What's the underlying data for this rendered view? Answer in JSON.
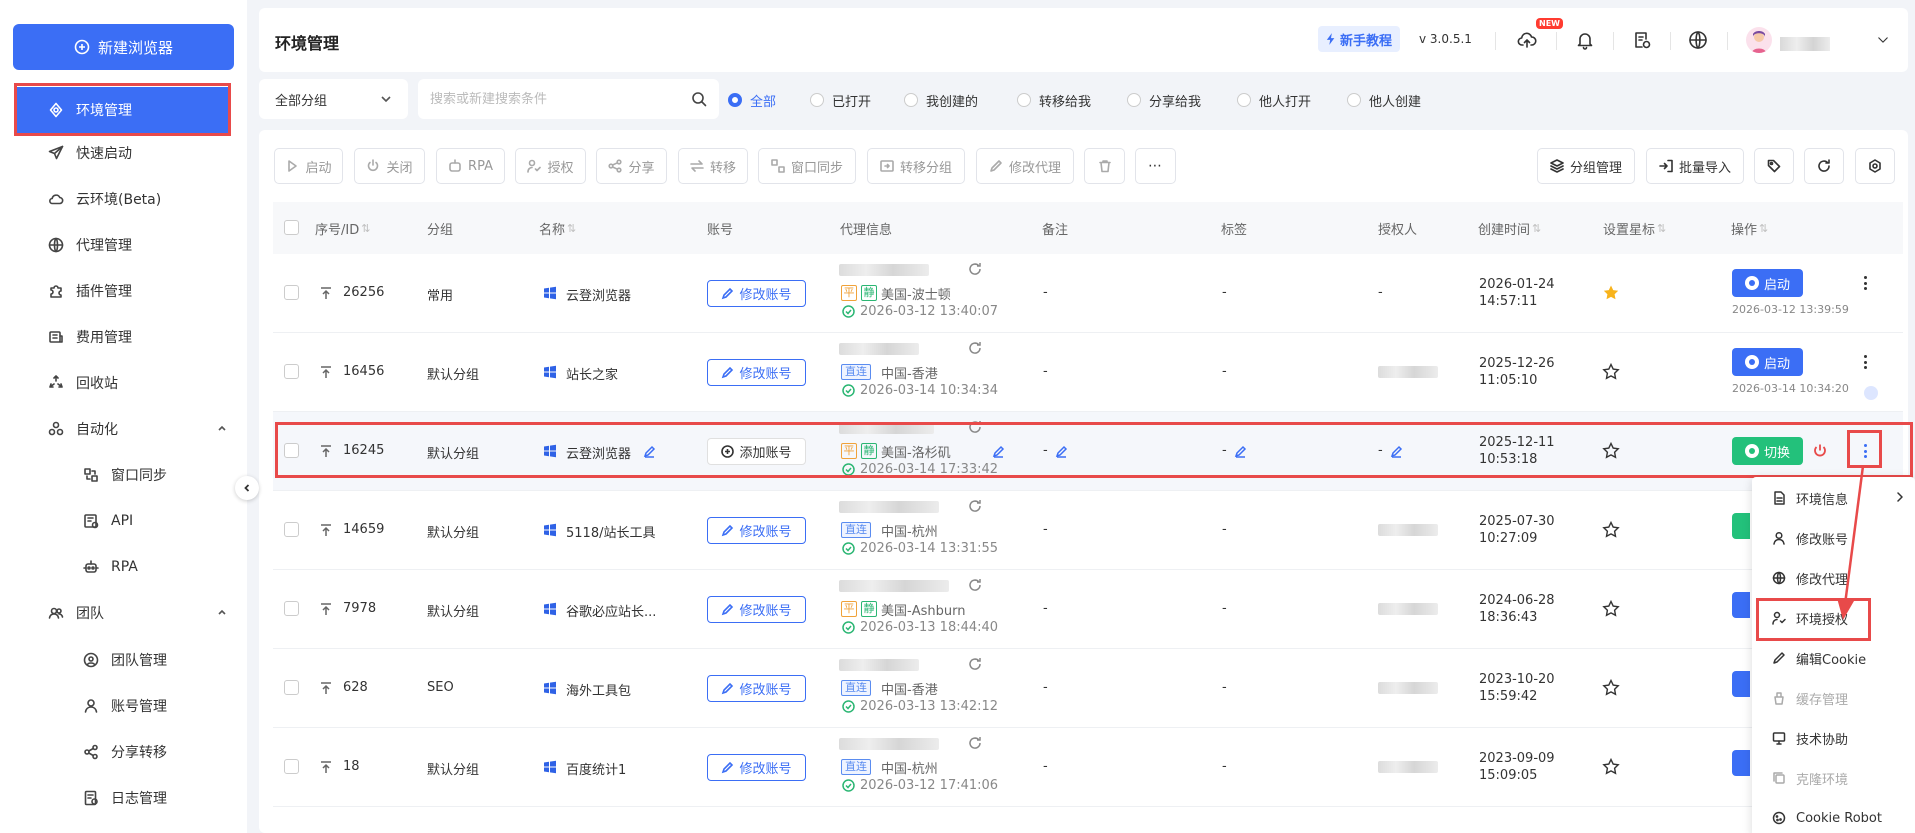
{
  "sidebar": {
    "new_browser_label": "新建浏览器",
    "items": [
      {
        "label": "环境管理",
        "icon": "environment-icon"
      },
      {
        "label": "快速启动",
        "icon": "paper-plane-icon"
      },
      {
        "label": "云环境(Beta)",
        "icon": "cloud-icon"
      },
      {
        "label": "代理管理",
        "icon": "globe-icon"
      },
      {
        "label": "插件管理",
        "icon": "plugin-icon"
      },
      {
        "label": "费用管理",
        "icon": "billing-icon"
      },
      {
        "label": "回收站",
        "icon": "recycle-icon"
      },
      {
        "label": "自动化",
        "icon": "automation-icon"
      },
      {
        "label": "窗口同步",
        "icon": "window-sync-icon"
      },
      {
        "label": "API",
        "icon": "api-icon"
      },
      {
        "label": "RPA",
        "icon": "robot-icon"
      },
      {
        "label": "团队",
        "icon": "team-icon"
      },
      {
        "label": "团队管理",
        "icon": "team-manage-icon"
      },
      {
        "label": "账号管理",
        "icon": "user-icon"
      },
      {
        "label": "分享转移",
        "icon": "share-icon"
      },
      {
        "label": "日志管理",
        "icon": "log-icon"
      }
    ]
  },
  "header": {
    "title": "环境管理",
    "tutorial_label": "新手教程",
    "version": "v 3.0.5.1",
    "new_badge": "NEW"
  },
  "filters": {
    "group_select": "全部分组",
    "search_placeholder": "搜索或新建搜索条件",
    "radios": [
      "全部",
      "已打开",
      "我创建的",
      "转移给我",
      "分享给我",
      "他人打开",
      "他人创建"
    ]
  },
  "toolbar": {
    "left": [
      "启动",
      "关闭",
      "RPA",
      "授权",
      "分享",
      "转移",
      "窗口同步",
      "转移分组",
      "修改代理"
    ],
    "right": [
      "分组管理",
      "批量导入"
    ]
  },
  "table": {
    "headers": [
      "序号/ID",
      "分组",
      "名称",
      "账号",
      "代理信息",
      "备注",
      "标签",
      "授权人",
      "创建时间",
      "设置星标",
      "操作"
    ],
    "rows": [
      {
        "id": "26256",
        "group": "常用",
        "name": "云登浏览器",
        "account": "修改账号",
        "location": "美国-波士顿",
        "check_time": "2026-03-12 13:40:07",
        "note": "-",
        "tag": "-",
        "auth": "-",
        "created_date": "2026-01-24",
        "created_time": "14:57:11",
        "starred": true,
        "op_label": "启动",
        "op_time": "2026-03-12 13:39:59"
      },
      {
        "id": "16456",
        "group": "默认分组",
        "name": "站长之家",
        "account": "修改账号",
        "location": "中国-香港",
        "check_time": "2026-03-14 10:34:34",
        "note": "-",
        "tag": "-",
        "auth": "",
        "created_date": "2025-12-26",
        "created_time": "11:05:10",
        "starred": false,
        "op_label": "启动",
        "op_time": "2026-03-14 10:34:20"
      },
      {
        "id": "16245",
        "group": "默认分组",
        "name": "云登浏览器",
        "account": "添加账号",
        "location": "美国-洛杉矶",
        "check_time": "2026-03-14 17:33:42",
        "note": "-",
        "tag": "-",
        "auth": "-",
        "created_date": "2025-12-11",
        "created_time": "10:53:18",
        "starred": false,
        "op_label": "切换",
        "op_time": ""
      },
      {
        "id": "14659",
        "group": "默认分组",
        "name": "5118/站长工具",
        "account": "修改账号",
        "location": "中国-杭州",
        "check_time": "2026-03-14 13:31:55",
        "note": "-",
        "tag": "-",
        "auth": "",
        "created_date": "2025-07-30",
        "created_time": "10:27:09",
        "starred": false
      },
      {
        "id": "7978",
        "group": "默认分组",
        "name": "谷歌必应站长...",
        "account": "修改账号",
        "location": "美国-Ashburn",
        "check_time": "2026-03-13 18:44:40",
        "note": "-",
        "tag": "-",
        "auth": "",
        "created_date": "2024-06-28",
        "created_time": "18:36:43",
        "starred": false
      },
      {
        "id": "628",
        "group": "SEO",
        "name": "海外工具包",
        "account": "修改账号",
        "location": "中国-香港",
        "check_time": "2026-03-13 13:42:12",
        "note": "-",
        "tag": "-",
        "auth": "",
        "created_date": "2023-10-20",
        "created_time": "15:59:42",
        "starred": false
      },
      {
        "id": "18",
        "group": "默认分组",
        "name": "百度统计1",
        "account": "修改账号",
        "location": "中国-杭州",
        "check_time": "2026-03-12 17:41:06",
        "note": "-",
        "tag": "-",
        "auth": "",
        "created_date": "2023-09-09",
        "created_time": "15:09:05",
        "starred": false
      }
    ],
    "tag_ping": "平",
    "tag_jing": "静",
    "tag_zhi": "直连"
  },
  "context_menu": {
    "items": [
      "环境信息",
      "修改账号",
      "修改代理",
      "环境授权",
      "编辑Cookie",
      "缓存管理",
      "技术协助",
      "克隆环境",
      "Cookie Robot"
    ]
  },
  "colors": {
    "primary": "#3b6ef5",
    "success": "#23c17b",
    "highlight": "#e84a4a",
    "star": "#f8b31b"
  }
}
